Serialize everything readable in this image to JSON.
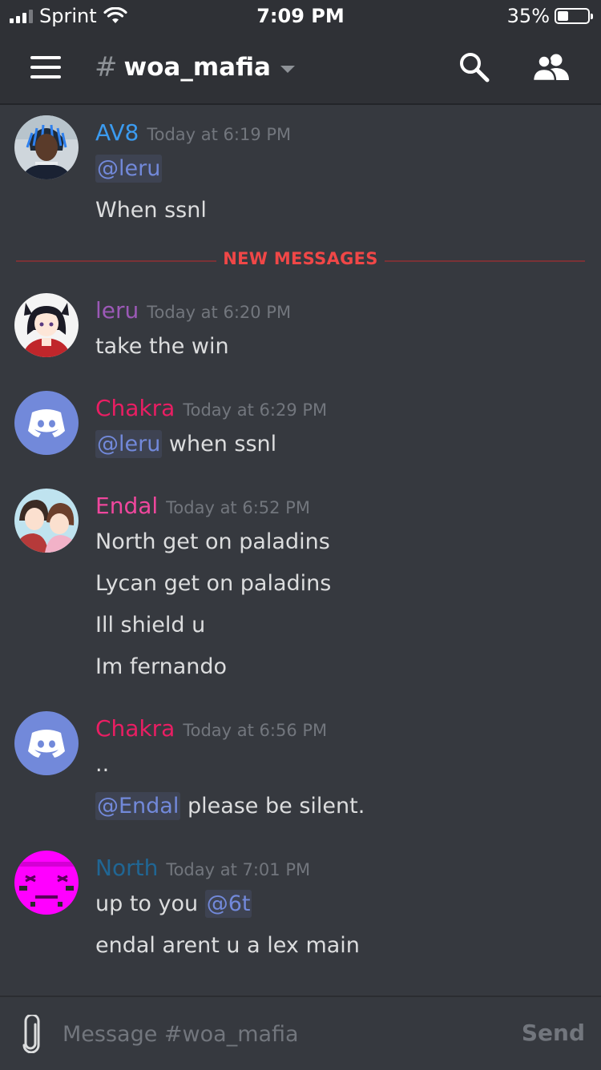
{
  "status_bar": {
    "carrier": "Sprint",
    "time": "7:09 PM",
    "battery": "35%",
    "battery_level": 0.35
  },
  "header": {
    "channel_name": "woa_mafia"
  },
  "divider": {
    "label": "NEW MESSAGES"
  },
  "messages": [
    {
      "author": "AV8",
      "author_color": "#3b9bf0",
      "timestamp": "Today at 6:19 PM",
      "lines": [
        {
          "mention": "@leru",
          "text": ""
        },
        {
          "mention": "",
          "text": "When ssnl"
        }
      ]
    },
    {
      "author": "leru",
      "author_color": "#9b59b6",
      "timestamp": "Today at 6:20 PM",
      "lines": [
        {
          "mention": "",
          "text": "take the win"
        }
      ]
    },
    {
      "author": "Chakra",
      "author_color": "#e91e63",
      "timestamp": "Today at 6:29 PM",
      "lines": [
        {
          "mention": "@leru",
          "text": " when ssnl"
        }
      ]
    },
    {
      "author": "Endal",
      "author_color": "#f0479d",
      "timestamp": "Today at 6:52 PM",
      "lines": [
        {
          "mention": "",
          "text": "North get on paladins"
        },
        {
          "mention": "",
          "text": "Lycan get on paladins"
        },
        {
          "mention": "",
          "text": "Ill shield u"
        },
        {
          "mention": "",
          "text": "Im fernando"
        }
      ]
    },
    {
      "author": "Chakra",
      "author_color": "#e91e63",
      "timestamp": "Today at 6:56 PM",
      "lines": [
        {
          "mention": "",
          "text": ".."
        },
        {
          "mention": "@Endal",
          "text": " please be silent."
        }
      ]
    },
    {
      "author": "North",
      "author_color": "#206694",
      "timestamp": "Today at 7:01 PM",
      "lines": [
        {
          "prefix": "up to you ",
          "mention": "@6t",
          "text": ""
        },
        {
          "mention": "",
          "text": "endal arent u a lex main"
        }
      ]
    }
  ],
  "composer": {
    "placeholder": "Message #woa_mafia",
    "send_label": "Send"
  },
  "colors": {
    "background": "#36393f",
    "header": "#2f3136",
    "mention": "#7289da",
    "new_messages": "#f04747",
    "blurple": "#7289da"
  },
  "icons": [
    "hamburger-menu-icon",
    "search-icon",
    "members-icon",
    "attachment-icon",
    "discord-logo-icon",
    "wifi-icon",
    "signal-icon",
    "battery-icon"
  ]
}
